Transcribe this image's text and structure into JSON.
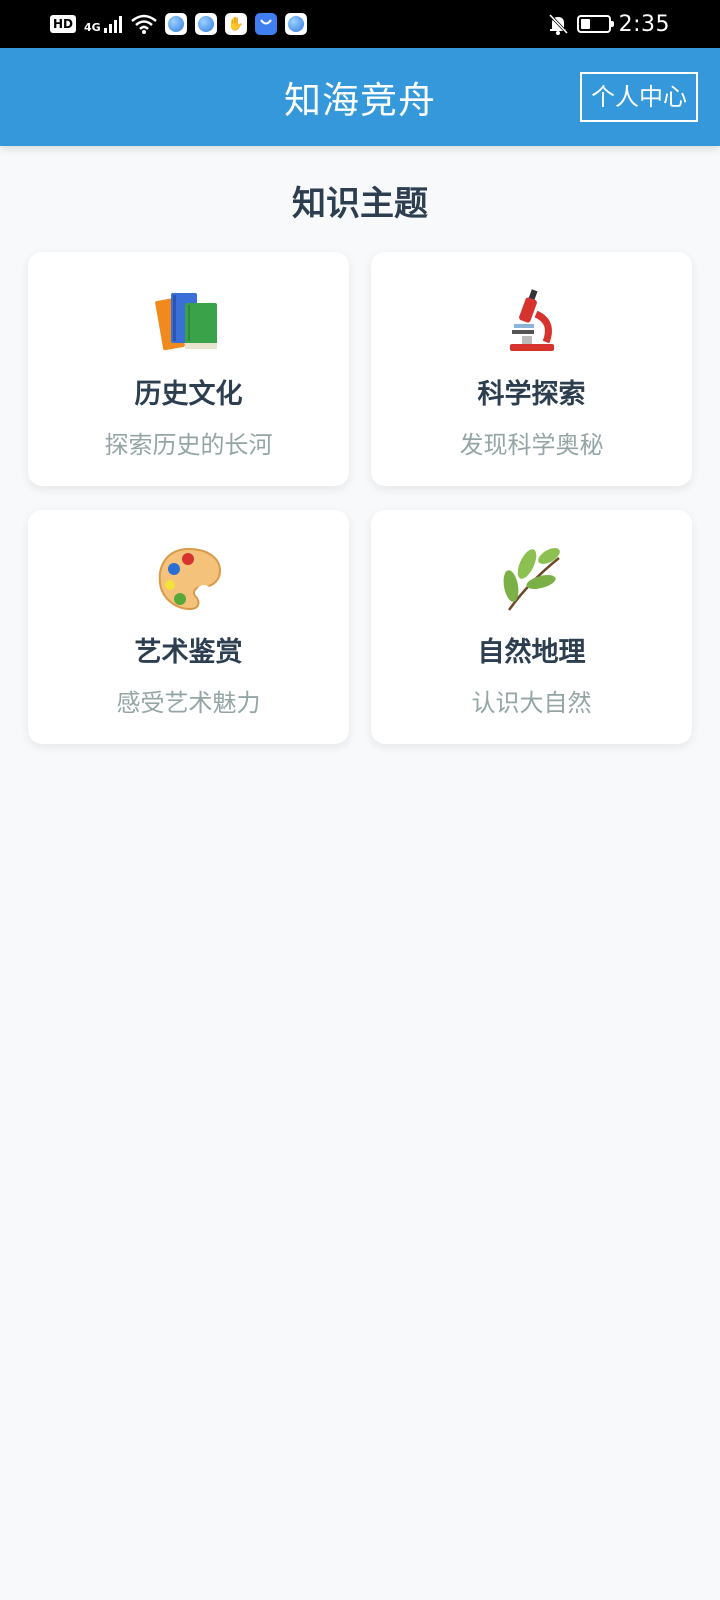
{
  "status_bar": {
    "network_badge": "HD",
    "network_type": "4G",
    "time": "2:35",
    "battery_level": 0.35
  },
  "header": {
    "title": "知海竞舟",
    "profile_button": "个人中心"
  },
  "section": {
    "title": "知识主题"
  },
  "topics": [
    {
      "name": "历史文化",
      "desc": "探索历史的长河",
      "icon": "books-icon"
    },
    {
      "name": "科学探索",
      "desc": "发现科学奥秘",
      "icon": "microscope-icon"
    },
    {
      "name": "艺术鉴赏",
      "desc": "感受艺术魅力",
      "icon": "palette-icon"
    },
    {
      "name": "自然地理",
      "desc": "认识大自然",
      "icon": "herb-icon"
    }
  ],
  "colors": {
    "header_bg": "#3498db",
    "page_bg": "#f7f9fb",
    "title_text": "#2c3e50",
    "desc_text": "#95a5a6"
  }
}
